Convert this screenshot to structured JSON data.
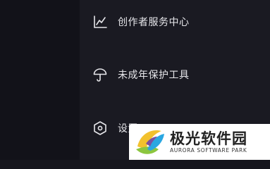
{
  "menu": {
    "items": [
      {
        "label": "创作者服务中心",
        "icon": "chart-line-icon"
      },
      {
        "label": "未成年保护工具",
        "icon": "umbrella-icon"
      },
      {
        "label": "设置",
        "icon": "settings-hexagon-icon"
      }
    ]
  },
  "watermark": {
    "title": "极光软件园",
    "subtitle": "AURORA SOFTWARE PARK",
    "colors": {
      "yellow": "#f2c12e",
      "green": "#8cc63f",
      "blue": "#2aa7e1",
      "purple": "#7b4fa0"
    }
  },
  "colors": {
    "background": "#16161d",
    "panel": "#1a1a22",
    "text": "#e6e6ea"
  }
}
